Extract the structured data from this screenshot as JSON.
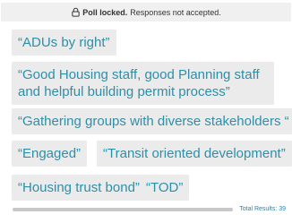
{
  "banner": {
    "icon": "padlock-icon",
    "bold_text": "Poll locked.",
    "text": "Responses not accepted."
  },
  "responses": [
    "“ADUs by right”",
    "“Good Housing staff, good Planning staff and helpful building permit process”",
    "“Gathering groups with diverse stakeholders “",
    "“Engaged”",
    "“Transit oriented development”",
    "“Housing trust bond”",
    "“TOD”"
  ],
  "footer": {
    "total_label": "Total Results: 39"
  },
  "colors": {
    "chip_bg": "#ebebeb",
    "chip_text": "#2e8fa8",
    "banner_bg": "#f0f0f0",
    "link": "#2f7fb0"
  }
}
